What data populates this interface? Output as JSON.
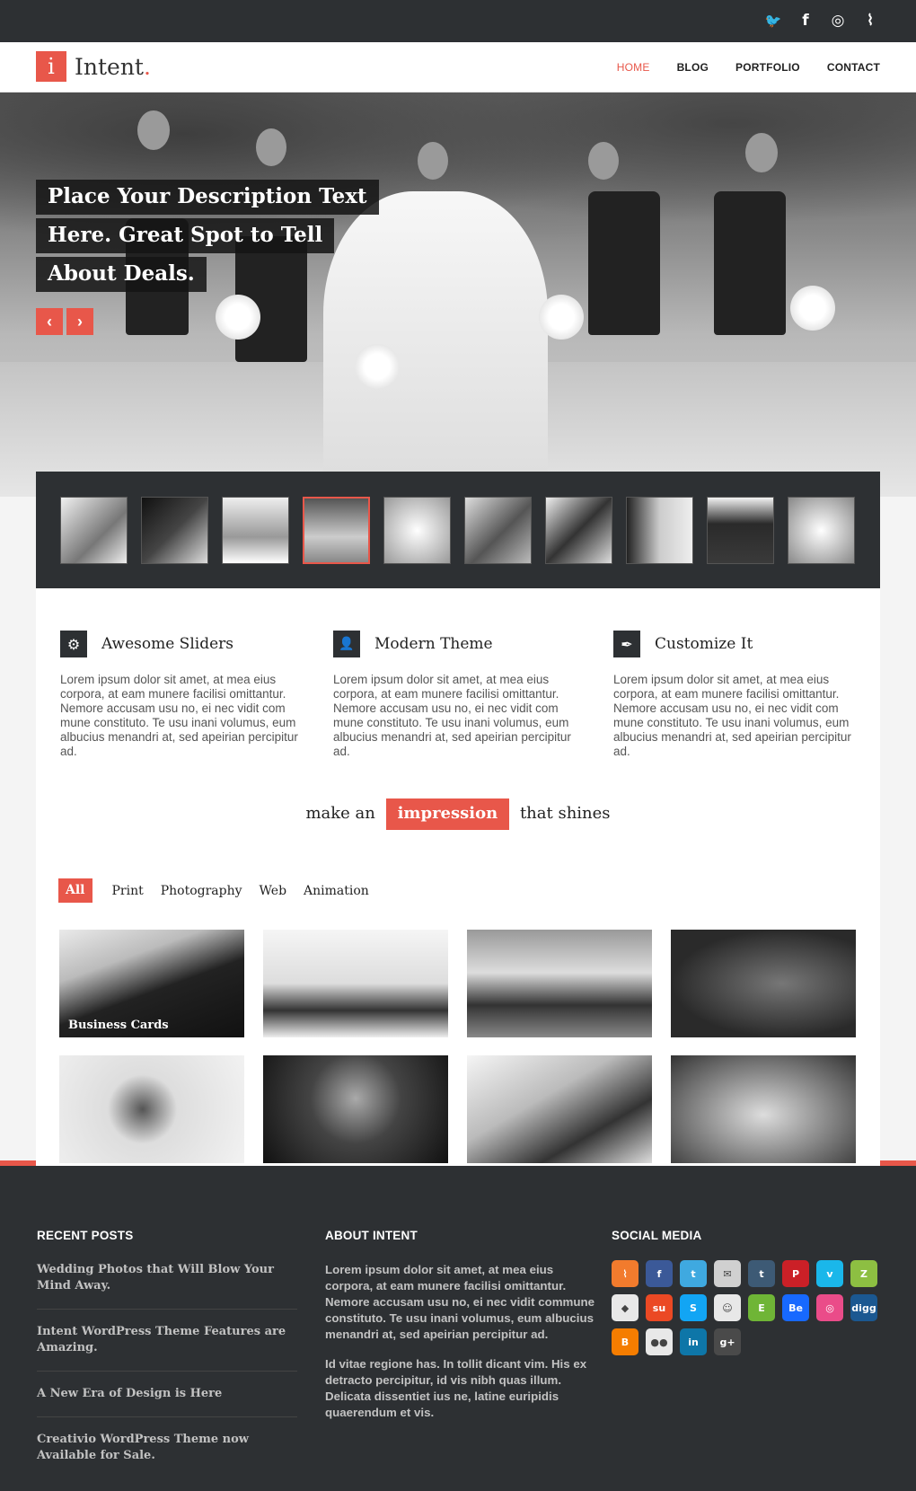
{
  "topbar": {
    "social": [
      {
        "icon": "twitter-icon",
        "glyph": "🐦"
      },
      {
        "icon": "facebook-icon",
        "glyph": "f"
      },
      {
        "icon": "dribbble-icon",
        "glyph": "◎"
      },
      {
        "icon": "rss-icon",
        "glyph": "⌇"
      }
    ]
  },
  "header": {
    "logo_letter": "i",
    "logo_text": "Intent",
    "logo_dot": ".",
    "nav": [
      "HOME",
      "BLOG",
      "PORTFOLIO",
      "CONTACT"
    ],
    "active": "HOME"
  },
  "hero": {
    "caption_lines": [
      "Place Your Description Text",
      "Here. Great Spot to Tell",
      "About Deals."
    ],
    "prev": "‹",
    "next": "›"
  },
  "thumbnails": {
    "count": 10,
    "active_index": 3
  },
  "features": [
    {
      "icon": "gear-icon",
      "glyph": "⚙",
      "title": "Awesome Sliders",
      "text": "Lorem ipsum dolor sit amet, at mea eius corpora, at eam munere facilisi omittantur. Nemore accusam usu no, ei nec vidit com mune constituto. Te usu inani volumus, eum albucius menandri at, sed apeirian percipitur ad."
    },
    {
      "icon": "user-icon",
      "glyph": "👤",
      "title": "Modern Theme",
      "text": "Lorem ipsum dolor sit amet, at mea eius corpora, at eam munere facilisi omittantur. Nemore accusam usu no, ei nec vidit com mune constituto. Te usu inani volumus, eum albucius menandri at, sed apeirian percipitur ad."
    },
    {
      "icon": "pen-icon",
      "glyph": "✒",
      "title": "Customize It",
      "text": "Lorem ipsum dolor sit amet, at mea eius corpora, at eam munere facilisi omittantur. Nemore accusam usu no, ei nec vidit com mune constituto. Te usu inani volumus, eum albucius menandri at, sed apeirian percipitur ad."
    }
  ],
  "tagline": {
    "before": "make an",
    "highlight": "impression",
    "after": "that shines"
  },
  "filters": {
    "items": [
      "All",
      "Print",
      "Photography",
      "Web",
      "Animation"
    ],
    "selected": "All"
  },
  "portfolio": {
    "first_label": "Business Cards"
  },
  "footer": {
    "recent_posts": {
      "heading": "RECENT POSTS",
      "posts": [
        "Wedding Photos that Will Blow Your Mind Away.",
        "Intent WordPress Theme Features are Amazing.",
        "A New Era of Design is Here",
        "Creativio WordPress Theme now Available for Sale."
      ]
    },
    "about": {
      "heading": "ABOUT INTENT",
      "paragraphs": [
        "Lorem ipsum dolor sit amet, at mea eius corpora, at eam munere facilisi omittantur. Nemore accusam usu no, ei nec vidit commune constituto. Te usu inani volumus, eum albucius menandri at, sed apeirian percipitur ad.",
        "Id vitae regione has. In tollit dicant vim. His ex detracto percipitur, id vis nibh quas illum. Delicata dissentiet ius ne, latine euripidis quaerendum et vis."
      ]
    },
    "social": {
      "heading": "SOCIAL MEDIA",
      "icons": [
        {
          "name": "rss-icon",
          "glyph": "⌇",
          "color": "#f27b2d"
        },
        {
          "name": "facebook-icon",
          "glyph": "f",
          "color": "#3b5998"
        },
        {
          "name": "twitter-icon",
          "glyph": "t",
          "color": "#3fa9e0"
        },
        {
          "name": "email-icon",
          "glyph": "✉",
          "color": "#d0d0d0"
        },
        {
          "name": "tumblr-icon",
          "glyph": "t",
          "color": "#3d5a75"
        },
        {
          "name": "pinterest-icon",
          "glyph": "P",
          "color": "#cb2027"
        },
        {
          "name": "vimeo-icon",
          "glyph": "v",
          "color": "#1ab7ea"
        },
        {
          "name": "zerply-icon",
          "glyph": "Z",
          "color": "#8dbf42"
        },
        {
          "name": "picasa-icon",
          "glyph": "◆",
          "color": "#e8e8e8"
        },
        {
          "name": "stumbleupon-icon",
          "glyph": "su",
          "color": "#eb4924"
        },
        {
          "name": "skype-icon",
          "glyph": "S",
          "color": "#12a5f4"
        },
        {
          "name": "reddit-icon",
          "glyph": "☺",
          "color": "#e8e8e8"
        },
        {
          "name": "evernote-icon",
          "glyph": "E",
          "color": "#6fb536"
        },
        {
          "name": "behance-icon",
          "glyph": "Be",
          "color": "#1769ff"
        },
        {
          "name": "dribbble-icon",
          "glyph": "◎",
          "color": "#ea4c89"
        },
        {
          "name": "digg-icon",
          "glyph": "digg",
          "color": "#1b5891"
        },
        {
          "name": "blogger-icon",
          "glyph": "B",
          "color": "#f57d00"
        },
        {
          "name": "flickr-icon",
          "glyph": "●●",
          "color": "#e8e8e8"
        },
        {
          "name": "linkedin-icon",
          "glyph": "in",
          "color": "#0e76a8"
        },
        {
          "name": "googleplus-icon",
          "glyph": "g+",
          "color": "#4a4a4a"
        }
      ]
    }
  }
}
